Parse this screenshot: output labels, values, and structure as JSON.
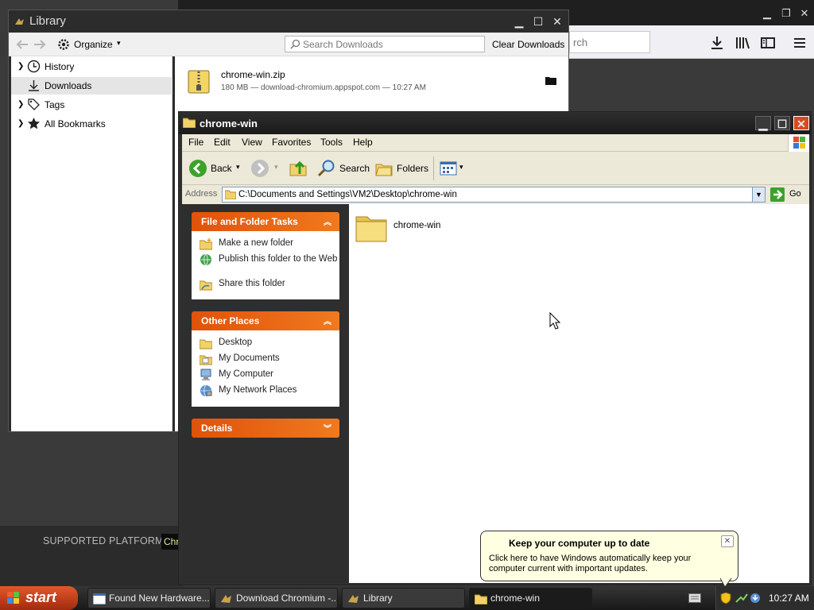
{
  "firefox": {
    "search_placeholder": "rch",
    "supported_platforms_label": "SUPPORTED PLATFORMS:",
    "platform_chip": "Chr"
  },
  "library": {
    "title": "Library",
    "organize_label": "Organize",
    "search_placeholder": "Search Downloads",
    "clear_downloads_label": "Clear Downloads",
    "sidebar": [
      {
        "label": "History",
        "icon": "clock-icon",
        "expandable": true
      },
      {
        "label": "Downloads",
        "icon": "download-arrow-icon",
        "expandable": false,
        "selected": true
      },
      {
        "label": "Tags",
        "icon": "tag-icon",
        "expandable": true
      },
      {
        "label": "All Bookmarks",
        "icon": "star-icon",
        "expandable": true
      }
    ],
    "download": {
      "filename": "chrome-win.zip",
      "details": "180 MB — download-chromium.appspot.com — 10:27 AM",
      "icon": "zip-file-icon"
    }
  },
  "explorer": {
    "title": "chrome-win",
    "menu": [
      "File",
      "Edit",
      "View",
      "Favorites",
      "Tools",
      "Help"
    ],
    "toolbar": {
      "back": "Back",
      "search": "Search",
      "folders": "Folders"
    },
    "address_label": "Address",
    "address_value": "C:\\Documents and Settings\\VM2\\Desktop\\chrome-win",
    "go_label": "Go",
    "panels": {
      "file_tasks_title": "File and Folder Tasks",
      "file_tasks": [
        {
          "label": "Make a new folder",
          "icon": "new-folder-icon"
        },
        {
          "label": "Publish this folder to the Web",
          "icon": "publish-web-icon"
        },
        {
          "label": "Share this folder",
          "icon": "share-folder-icon"
        }
      ],
      "other_places_title": "Other Places",
      "other_places": [
        {
          "label": "Desktop",
          "icon": "folder-icon"
        },
        {
          "label": "My Documents",
          "icon": "my-documents-icon"
        },
        {
          "label": "My Computer",
          "icon": "computer-icon"
        },
        {
          "label": "My Network Places",
          "icon": "network-icon"
        }
      ],
      "details_title": "Details"
    },
    "items": [
      {
        "label": "chrome-win",
        "icon": "folder-icon"
      }
    ]
  },
  "balloon": {
    "title": "Keep your computer up to date",
    "body": "Click here to have Windows automatically keep your computer current with important updates."
  },
  "taskbar": {
    "start_label": "start",
    "tasks": [
      {
        "label": "Found New Hardware...",
        "active": false
      },
      {
        "label": "Download Chromium -...",
        "active": false
      },
      {
        "label": "Library",
        "active": false
      },
      {
        "label": "chrome-win",
        "active": true
      }
    ],
    "clock": "10:27 AM"
  },
  "colors": {
    "panel_header": "#e0520a",
    "balloon_bg": "#ffffe1",
    "start_button": "#c8401a",
    "window_frame": "#2c2c2c"
  }
}
